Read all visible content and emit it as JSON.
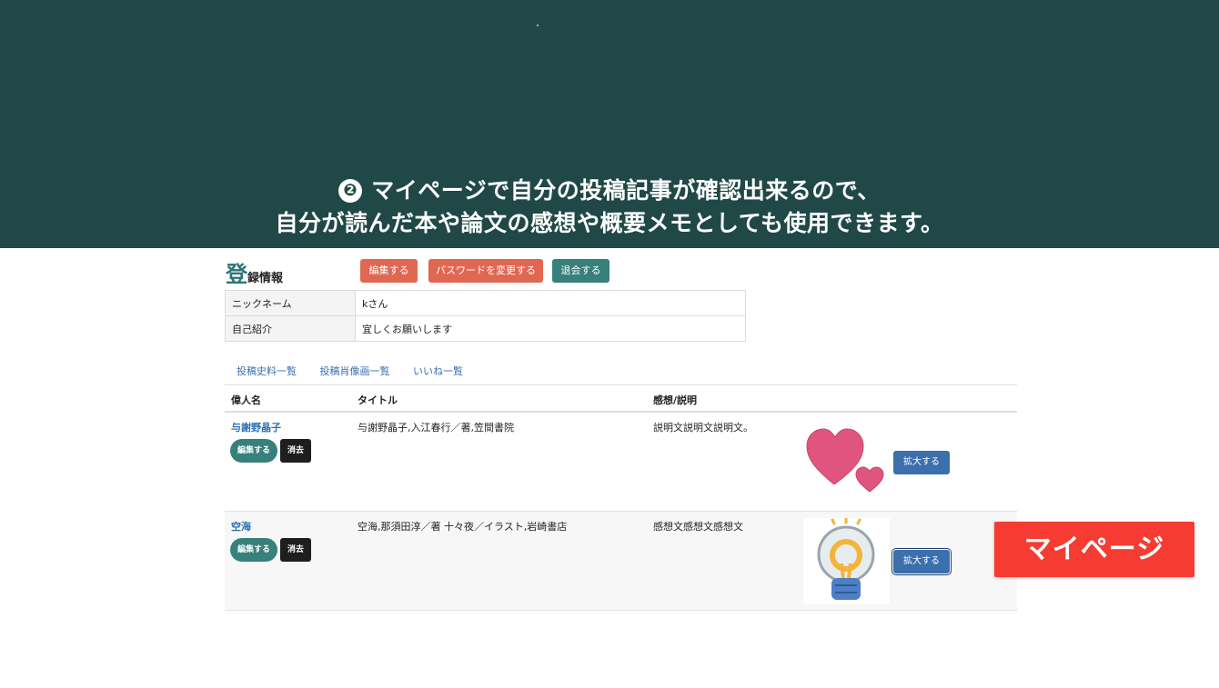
{
  "banner": {
    "step": "❷",
    "line1": "マイページで自分の投稿記事が確認出来るので、",
    "line2": "自分が読んだ本や論文の感想や概要メモとしても使用できます。"
  },
  "registration": {
    "title_big": "登",
    "title_small": "録情報",
    "buttons": {
      "edit": "編集する",
      "change_password": "パスワードを変更する",
      "withdraw": "退会する"
    },
    "fields": [
      {
        "label": "ニックネーム",
        "value": "kさん"
      },
      {
        "label": "自己紹介",
        "value": "宜しくお願いします"
      }
    ]
  },
  "tabs": [
    "投稿史料一覧",
    "投稿肖像画一覧",
    "いいね一覧"
  ],
  "posts_table": {
    "headers": {
      "person": "偉人名",
      "title": "タイトル",
      "impression": "感想/説明"
    },
    "rows": [
      {
        "person": "与謝野晶子",
        "title": "与謝野晶子,入江春行／著,笠間書院",
        "impression": "説明文説明文説明文。",
        "edit": "編集する",
        "delete": "消去",
        "zoom": "拡大する",
        "image_icon": "hearts-image"
      },
      {
        "person": "空海",
        "title": "空海,那須田淳／著 十々夜／イラスト,岩崎書店",
        "impression": "感想文感想文感想文",
        "edit": "編集する",
        "delete": "消去",
        "zoom": "拡大する",
        "image_icon": "lightbulb-image"
      }
    ]
  },
  "badge": "マイページ",
  "colors": {
    "banner": "#1f4847",
    "teal": "#37807c",
    "red_button": "#e06752",
    "badge": "#f63c32",
    "link": "#2f6db0"
  }
}
